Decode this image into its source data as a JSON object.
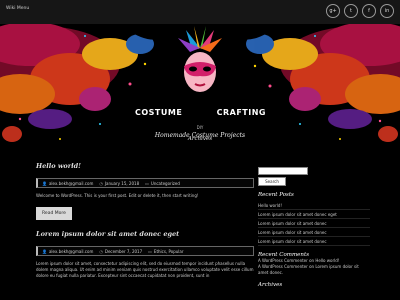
{
  "topbar": {
    "wiki_text": "Wiki Menu",
    "social": [
      {
        "icon": "google-plus-icon",
        "glyph": "g+"
      },
      {
        "icon": "twitter-icon",
        "glyph": "t"
      },
      {
        "icon": "facebook-icon",
        "glyph": "f"
      },
      {
        "icon": "linkedin-icon",
        "glyph": "in"
      }
    ]
  },
  "brand": {
    "costume": "COSTUME",
    "crafting": "CRAFTING",
    "diy": "DIY",
    "tagline": "Homemade Costume Projects"
  },
  "nav": {
    "archives": "Archives"
  },
  "posts": [
    {
      "title": "Hello world!",
      "author": "alex.bekh@gmail.com",
      "date": "January 15, 2018",
      "category": "Uncategorized",
      "excerpt": "Welcome to WordPress. This is your first post. Edit or delete it, then start writing!",
      "read_more": "Read More"
    },
    {
      "title": "Lorem ipsum dolor sit amet donec eget",
      "author": "alex.bekh@gmail.com",
      "date": "December 7, 2017",
      "category": "Ethics, Popular",
      "excerpt": "Lorem ipsum dolor sit amet, consectetur adipiscing elit, sed do eiusmod tempor incidunt phasellus nulla dolem magna aliqua. Ut enim ad minim veniam quis nostrud exercitation ullamco voluptate velit esse cillum dolore eu fugiat nulla pariatur. Excepteur sint occaecat cupidatat non proident, sunt in"
    }
  ],
  "sidebar": {
    "search_button": "Search",
    "recent_posts_title": "Recent Posts",
    "recent_posts": [
      "Hello world!",
      "Lorem ipsum dolor sit amet donec eget",
      "Lorem ipsum dolor sit amet donec",
      "Lorem ipsum dolor sit amet donec",
      "Lorem ipsum dolor sit amet donec"
    ],
    "recent_comments_title": "Recent Comments",
    "recent_comments": [
      {
        "who": "A WordPress Commenter",
        "on": "on",
        "post": "Hello world!"
      },
      {
        "who": "A WordPress Commenter",
        "on": "on",
        "post": "Lorem ipsum dolor sit amet donec."
      }
    ],
    "archives_title": "Archives"
  },
  "colors": {
    "background": "#000000",
    "button": "#d9d9d9",
    "text": "#dddddd"
  }
}
